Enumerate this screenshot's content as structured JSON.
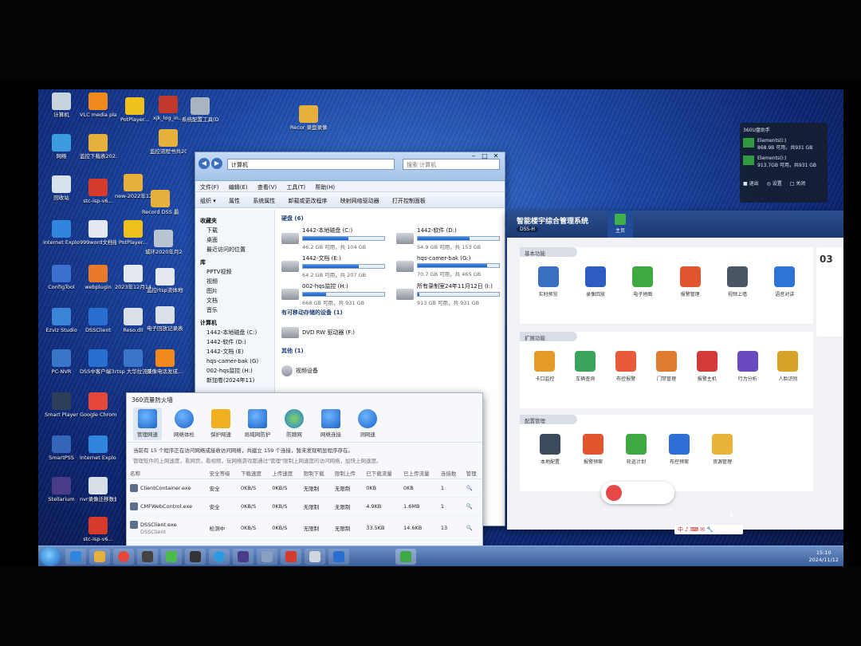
{
  "desktop": {
    "icons": [
      {
        "label": "计算机",
        "color": "#c9d3de"
      },
      {
        "label": "VLC media player",
        "color": "#f08a1c"
      },
      {
        "label": "PotPlayer...",
        "color": "#f0c11c"
      },
      {
        "label": "xjk_log_in...",
        "color": "#c0392b"
      },
      {
        "label": "系统配置工具(DSS-H)",
        "color": "#aab4c0"
      },
      {
        "label": "网络",
        "color": "#3b9ce0"
      },
      {
        "label": "监控下载表2022年4...",
        "color": "#e6b03a"
      },
      {
        "label": "监控流程书共2018年...",
        "color": "#e6b03a"
      },
      {
        "label": "回收站",
        "color": "#d7e1ea"
      },
      {
        "label": "stc-isp-v6...",
        "color": "#d63a2a"
      },
      {
        "label": "new-2022年12月9bak",
        "color": "#e6b03a"
      },
      {
        "label": "Record DSS 最新版(2)",
        "color": "#e6b03a"
      },
      {
        "label": "Internet Explorer",
        "color": "#2f86dc"
      },
      {
        "label": "999word文档批量修...",
        "color": "#e4e9ef"
      },
      {
        "label": "PotPlayer...",
        "color": "#f0c11c"
      },
      {
        "label": "城环2020年月23日17...",
        "color": "#b8c4d0"
      },
      {
        "label": "ConfigTool",
        "color": "#3d6fce"
      },
      {
        "label": "webplugin",
        "color": "#e87a2a"
      },
      {
        "label": "2023年12月14日监控...",
        "color": "#e4e9ef"
      },
      {
        "label": "监控rtsp流体地址2013...",
        "color": "#e4e9ef"
      },
      {
        "label": "Ezviz Studio",
        "color": "#3a84d8"
      },
      {
        "label": "DSSClient",
        "color": "#2a6ed0"
      },
      {
        "label": "Reso.dll",
        "color": "#d9e0e7"
      },
      {
        "label": "电子回放记录表...",
        "color": "#d9e0e7"
      },
      {
        "label": "PC-NVR",
        "color": "#3a76c8"
      },
      {
        "label": "DSS中客户端3.20",
        "color": "#2a6ed0"
      },
      {
        "label": "rtsp 大华拉流成功测试",
        "color": "#3a76c8"
      },
      {
        "label": "录像电话发成...撤消...",
        "color": "#f08a1c"
      },
      {
        "label": "Smart Player",
        "color": "#2d3e58"
      },
      {
        "label": "Google Chrome",
        "color": "#e5473b"
      },
      {
        "label": "SmartPSS",
        "color": "#3366b8"
      },
      {
        "label": "Internet Explorer",
        "color": "#2f86dc"
      },
      {
        "label": "Stellarium",
        "color": "#4a3a8a"
      },
      {
        "label": "nvr录像迁移数据库",
        "color": "#d8dfe6"
      },
      {
        "label": "stc-isp-v6...",
        "color": "#d63a2a"
      },
      {
        "label": "Recor 录盘录像行dD...",
        "color": "#e6b03a"
      }
    ]
  },
  "explorer": {
    "address": "计算机",
    "search_placeholder": "搜索 计算机",
    "menu": [
      "文件(F)",
      "编辑(E)",
      "查看(V)",
      "工具(T)",
      "帮助(H)"
    ],
    "toolbar": [
      "组织 ▾",
      "属性",
      "系统属性",
      "卸载或更改程序",
      "映射网络驱动器",
      "打开控制面板"
    ],
    "nav": {
      "favorites_header": "收藏夹",
      "favorites": [
        "下载",
        "桌面",
        "最近访问的位置"
      ],
      "libraries_header": "库",
      "libraries": [
        "PPTV视频",
        "视频",
        "图片",
        "文档",
        "音乐"
      ],
      "computer_header": "计算机",
      "computer": [
        "1442-本地磁盘 (C:)",
        "1442-软件 (D:)",
        "1442-文档 (E)",
        "hqs-camer-bak (G)",
        "002-hqs监控 (H:)",
        "新加卷(2024年11)"
      ]
    },
    "sections": {
      "hdd": "硬盘 (6)",
      "removable": "有可移动存储的设备 (1)",
      "other": "其他 (1)"
    },
    "drives": [
      {
        "name": "1442-本地磁盘 (C:)",
        "info": "46.2 GB 可用，共 104 GB",
        "fill": 0.56
      },
      {
        "name": "1442-软件 (D:)",
        "info": "54.9 GB 可用，共 153 GB",
        "fill": 0.64
      },
      {
        "name": "1442-文档 (E:)",
        "info": "64.2 GB 可用，共 207 GB",
        "fill": 0.69
      },
      {
        "name": "hqs-camer-bak (G:)",
        "info": "70.7 GB 可用，共 465 GB",
        "fill": 0.85
      },
      {
        "name": "002-hqs监控 (H:)",
        "info": "668 GB 可用，共 931 GB",
        "fill": 0.28
      },
      {
        "name": "所有录制室24年11月12日 (I:)",
        "info": "913 GB 可用，共 931 GB",
        "fill": 0.02
      }
    ],
    "removable": {
      "name": "DVD RW 驱动器 (F:)"
    },
    "other": {
      "name": "视频设备"
    }
  },
  "firewall": {
    "title": "360流量防火墙",
    "tabs": [
      "管理网速",
      "网络体检",
      "保护网速",
      "局域网防护",
      "防蹭网",
      "网络连接",
      "测网速"
    ],
    "summary": "当前有 15 个程序正在访问网络或接收访问网络，共建立 159 个连接，暂未发现明显程序存在。",
    "hint": "管理软件的上网速度，看网页，看视频，玩网络游戏都通过\"管理\"限制上网速度的访问网络，加快上网速度。",
    "columns": [
      "名称",
      "安全等级",
      "下载速度",
      "上传速度",
      "限制下载",
      "限制上传",
      "已下载流量",
      "已上传流量",
      "连接数",
      "管理"
    ],
    "rows": [
      {
        "name": "ClientContainer.exe",
        "level": "安全",
        "down": "0KB/S",
        "up": "0KB/S",
        "ldown": "无限制",
        "lup": "无限制",
        "downl": "0KB",
        "upl": "0KB",
        "conn": "1"
      },
      {
        "name": "CMFWebControl.exe",
        "level": "安全",
        "down": "0KB/S",
        "up": "0KB/S",
        "ldown": "无限制",
        "lup": "无限制",
        "downl": "4.9KB",
        "upl": "1.6MB",
        "conn": "1"
      },
      {
        "name": "DSSClient.exe",
        "level": "检测中",
        "down": "0KB/S",
        "up": "0KB/S",
        "ldown": "无限制",
        "lup": "无限制",
        "downl": "33.5KB",
        "upl": "14.6KB",
        "conn": "13",
        "sub": "DSSClient"
      }
    ]
  },
  "dss": {
    "title": "智能楼宇综合管理系统",
    "badge": "DSS-H",
    "home_tab": "主页",
    "right_num": "03",
    "panels": [
      {
        "title": "基本功能",
        "items": [
          {
            "label": "实时预览",
            "color": "#3a6fc0"
          },
          {
            "label": "录像回放",
            "color": "#2c5cc0"
          },
          {
            "label": "电子地图",
            "color": "#3ea843"
          },
          {
            "label": "报警管理",
            "color": "#e0552e"
          },
          {
            "label": "视频上墙",
            "color": "#4a5566"
          },
          {
            "label": "语音对讲",
            "color": "#2d74d6"
          }
        ]
      },
      {
        "title": "扩展功能",
        "items": [
          {
            "label": "卡口监控",
            "color": "#e59a2a"
          },
          {
            "label": "车辆查询",
            "color": "#3aa45a"
          },
          {
            "label": "布控报警",
            "color": "#e85a3a"
          },
          {
            "label": "门禁管理",
            "color": "#e07a30"
          },
          {
            "label": "报警主机",
            "color": "#d33a3a"
          },
          {
            "label": "行为分析",
            "color": "#6a4ac0"
          },
          {
            "label": "人脸识别",
            "color": "#d6a32a"
          }
        ]
      },
      {
        "title": "配置管理",
        "items": [
          {
            "label": "本地配置",
            "color": "#3c4a5e"
          },
          {
            "label": "报警预案",
            "color": "#e0552e"
          },
          {
            "label": "轮巡计划",
            "color": "#3ea843"
          },
          {
            "label": "布控预案",
            "color": "#2d6fd6"
          },
          {
            "label": "资源管理",
            "color": "#e6b43a"
          }
        ]
      }
    ]
  },
  "notification": {
    "title": "360U盘助手",
    "items": [
      {
        "name": "Elements(I:)",
        "info": "868.9B 可用，共931 GB"
      },
      {
        "name": "Elements(I:)",
        "info": "913.7GB 可用，共931 GB"
      }
    ],
    "actions": [
      "■ 退出",
      "◎ 设置",
      "□ 关闭"
    ]
  },
  "taskbar": {
    "ime": "中 ♪ ⌨ ✉ 🔧",
    "time": "15:10",
    "date": "2024/11/12"
  }
}
